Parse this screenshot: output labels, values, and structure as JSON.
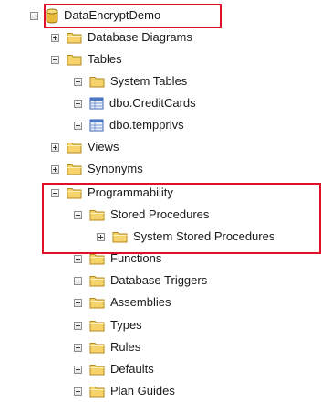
{
  "tree": {
    "root": {
      "label": "DataEncryptDemo",
      "icon": "database-icon"
    },
    "items": [
      {
        "label": "Database Diagrams",
        "icon": "folder-icon",
        "state": "collapsed"
      },
      {
        "label": "Tables",
        "icon": "folder-icon",
        "state": "expanded"
      },
      {
        "label": "System Tables",
        "icon": "folder-icon",
        "state": "collapsed"
      },
      {
        "label": "dbo.CreditCards",
        "icon": "table-icon",
        "state": "collapsed"
      },
      {
        "label": "dbo.tempprivs",
        "icon": "table-icon",
        "state": "collapsed"
      },
      {
        "label": "Views",
        "icon": "folder-icon",
        "state": "collapsed"
      },
      {
        "label": "Synonyms",
        "icon": "folder-icon",
        "state": "collapsed"
      },
      {
        "label": "Programmability",
        "icon": "folder-icon",
        "state": "expanded"
      },
      {
        "label": "Stored Procedures",
        "icon": "folder-icon",
        "state": "expanded"
      },
      {
        "label": "System Stored Procedures",
        "icon": "folder-icon",
        "state": "collapsed"
      },
      {
        "label": "Functions",
        "icon": "folder-icon",
        "state": "collapsed"
      },
      {
        "label": "Database Triggers",
        "icon": "folder-icon",
        "state": "collapsed"
      },
      {
        "label": "Assemblies",
        "icon": "folder-icon",
        "state": "collapsed"
      },
      {
        "label": "Types",
        "icon": "folder-icon",
        "state": "collapsed"
      },
      {
        "label": "Rules",
        "icon": "folder-icon",
        "state": "collapsed"
      },
      {
        "label": "Defaults",
        "icon": "folder-icon",
        "state": "collapsed"
      },
      {
        "label": "Plan Guides",
        "icon": "folder-icon",
        "state": "collapsed"
      }
    ]
  },
  "colors": {
    "highlight_border": "#e0102a",
    "folder_fill": "#f7d36b",
    "table_fill": "#4a78c6"
  }
}
